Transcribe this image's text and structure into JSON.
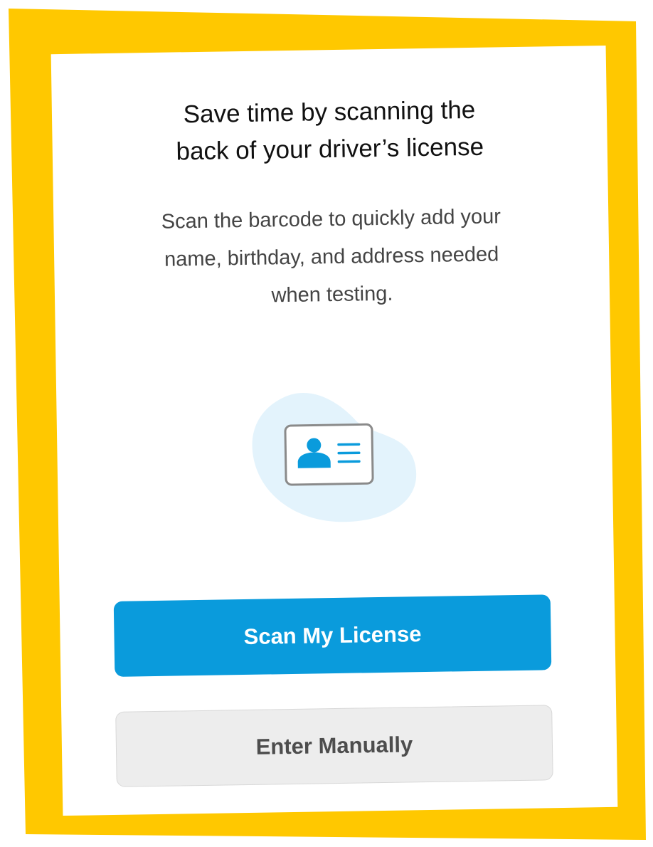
{
  "colors": {
    "frame": "#ffc800",
    "card": "#ffffff",
    "primary": "#0a9bdc",
    "secondary_bg": "#ededed",
    "blob": "#e3f3fc"
  },
  "header": {
    "title_line1": "Save time by scanning the",
    "title_line2": "back of your driver’s license"
  },
  "body": {
    "desc_line1": "Scan the barcode to quickly add your",
    "desc_line2": "name, birthday, and address needed",
    "desc_line3": "when testing."
  },
  "illustration": {
    "icon": "id-card-icon"
  },
  "actions": {
    "scan_label": "Scan My License",
    "manual_label": "Enter Manually"
  }
}
